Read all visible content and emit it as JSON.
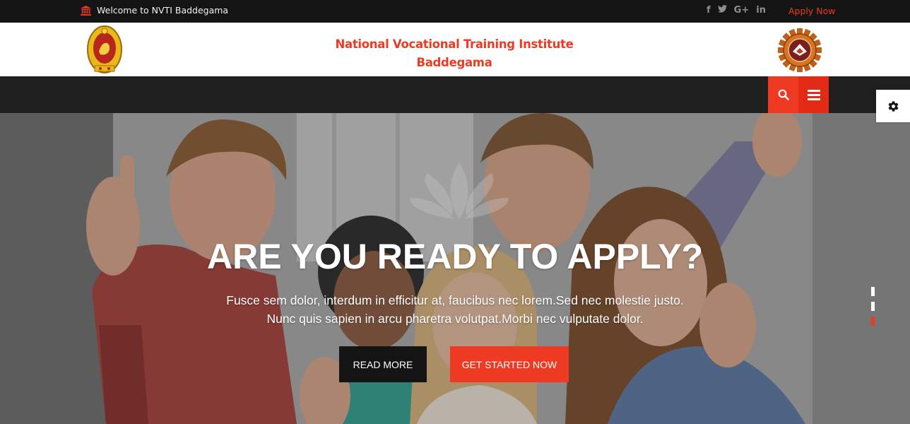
{
  "topbar": {
    "welcome_icon": "bank-icon",
    "welcome_text": "Welcome to NVTI Baddegama",
    "social": [
      {
        "icon": "facebook-icon",
        "glyph": "f"
      },
      {
        "icon": "twitter-icon",
        "glyph": "🐦"
      },
      {
        "icon": "google-plus-icon",
        "glyph": "G+"
      },
      {
        "icon": "linkedin-icon",
        "glyph": "in"
      }
    ],
    "apply_label": "Apply Now"
  },
  "header": {
    "title_line1": "National Vocational Training Institute",
    "title_line2": "Baddegama",
    "left_emblem": "sri-lanka-emblem",
    "right_emblem": "vta-gear-logo"
  },
  "nav": {
    "search_icon": "search-icon",
    "menu_icon": "hamburger-icon",
    "settings_icon": "gear-icon"
  },
  "hero": {
    "title": "ARE YOU READY TO APPLY?",
    "text_line1": "Fusce sem dolor, interdum in efficitur at, faucibus nec lorem.Sed nec molestie justo.",
    "text_line2": "Nunc quis sapien in arcu pharetra volutpat.Morbi nec vulputate dolor.",
    "btn_read": "READ MORE",
    "btn_start": "GET STARTED NOW",
    "slides": 3,
    "active_slide": 3
  },
  "colors": {
    "accent": "#ee3a23",
    "topbar_bg": "#141414",
    "nav_bg": "#1f1f1f"
  }
}
